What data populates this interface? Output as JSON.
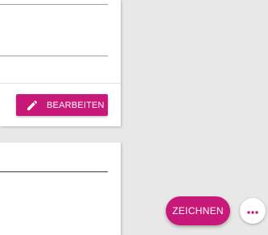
{
  "edit_card": {
    "edit_button_label": "BEARBEITEN",
    "edit_icon": "pencil-icon"
  },
  "fab": {
    "draw_button_label": "ZEICHNEN",
    "more_icon": "more-horizontal-icon"
  },
  "colors": {
    "accent": "#c8197a",
    "background": "#e8e8e8",
    "card": "#ffffff"
  }
}
